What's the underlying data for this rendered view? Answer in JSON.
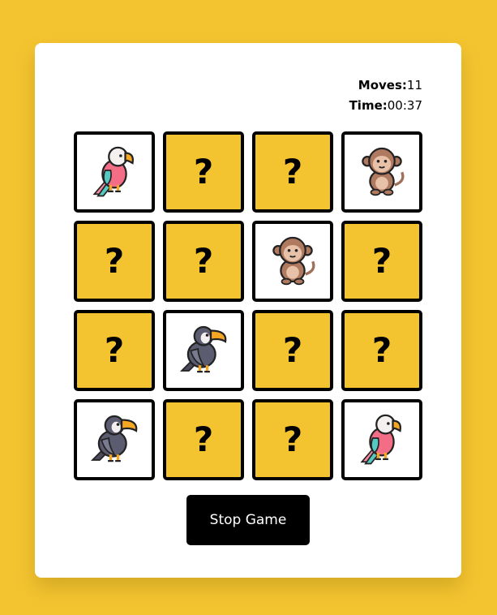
{
  "stats": {
    "moves_label": "Moves:",
    "moves_value": "11",
    "time_label": "Time:",
    "time_value": "00:37"
  },
  "board": {
    "hidden_symbol": "?",
    "tiles": [
      {
        "state": "revealed",
        "icon": "parrot-icon"
      },
      {
        "state": "hidden"
      },
      {
        "state": "hidden"
      },
      {
        "state": "revealed",
        "icon": "monkey-icon"
      },
      {
        "state": "hidden"
      },
      {
        "state": "hidden"
      },
      {
        "state": "revealed",
        "icon": "monkey-icon"
      },
      {
        "state": "hidden"
      },
      {
        "state": "hidden"
      },
      {
        "state": "revealed",
        "icon": "toucan-icon"
      },
      {
        "state": "hidden"
      },
      {
        "state": "hidden"
      },
      {
        "state": "revealed",
        "icon": "toucan-icon"
      },
      {
        "state": "hidden"
      },
      {
        "state": "hidden"
      },
      {
        "state": "revealed",
        "icon": "parrot-icon"
      }
    ]
  },
  "controls": {
    "stop_label": "Stop Game"
  },
  "colors": {
    "background": "#f4c430",
    "hidden_tile": "#f4c430",
    "panel": "#ffffff",
    "button": "#000000"
  }
}
